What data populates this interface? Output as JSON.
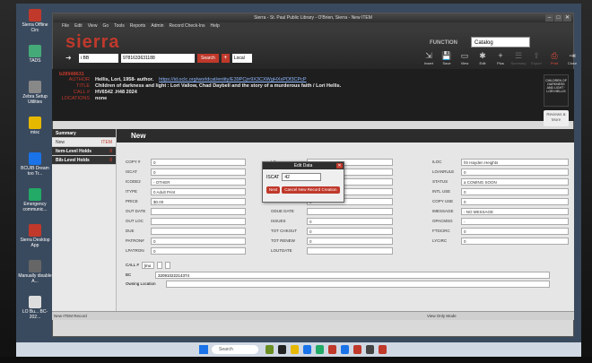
{
  "window": {
    "title": "Sierra - St. Paul Public Library - O'Brien, Sierra - New ITEM",
    "buttons": [
      "–",
      "□",
      "✕"
    ]
  },
  "menu": [
    "File",
    "Edit",
    "View",
    "Go",
    "Tools",
    "Reports",
    "Admin",
    "Record Check-Ins",
    "Help"
  ],
  "header": {
    "logo": "sierra",
    "function_label": "FUNCTION",
    "function_value": "Catalog",
    "search_index": "i BB",
    "search_value": "9781633631188",
    "search_button": "Search",
    "scope": "Local",
    "toolbar": [
      {
        "label": "Insert",
        "icon": "insert-icon",
        "glyph": "⇲",
        "state": "normal"
      },
      {
        "label": "Save",
        "icon": "save-icon",
        "glyph": "💾",
        "state": "normal"
      },
      {
        "label": "View",
        "icon": "view-icon",
        "glyph": "▭",
        "state": "normal"
      },
      {
        "label": "Edit",
        "icon": "edit-icon",
        "glyph": "✱",
        "state": "normal"
      },
      {
        "label": "Plus",
        "icon": "plus-icon",
        "glyph": "+",
        "state": "normal"
      },
      {
        "label": "Summary",
        "icon": "summary-icon",
        "glyph": "☰",
        "state": "dim"
      },
      {
        "label": "Export",
        "icon": "export-icon",
        "glyph": "⇪",
        "state": "dim"
      },
      {
        "label": "Print",
        "icon": "print-icon",
        "glyph": "⎙",
        "state": "red"
      },
      {
        "label": "Close",
        "icon": "close-icon",
        "glyph": "⇥",
        "state": "normal"
      }
    ]
  },
  "brief": {
    "record_number": "b28948631",
    "rows": [
      {
        "label": "AUTHOR",
        "value": "Hellis, Lori, 1958- author.",
        "link": "https://id.oclc.org/worldcat/entity/E39PCjrr9X3CXWgHXxPDf3CPcP"
      },
      {
        "label": "TITLE",
        "value": "Children of darkness and light : Lori Vallow, Chad Daybell and the story of a murderous faith / Lori Hellis.",
        "link": ""
      },
      {
        "label": "CALL #",
        "value": "HV6542 .H48 2024",
        "link": ""
      },
      {
        "label": "LOCATIONS",
        "value": "none",
        "link": ""
      }
    ],
    "cover_text": "CHILDREN OF DARKNESS AND LIGHT · LORI HELLIS",
    "reviews": "Reviews & More"
  },
  "nav": {
    "summary": "Summary",
    "new_label": "New",
    "new_tag": "ITEM",
    "item_holds": "Item-Level Holds",
    "bib_holds": "Bib-Level Holds",
    "count_item": "0",
    "count_bib": "0"
  },
  "main": {
    "heading": "New",
    "left_fields": [
      {
        "label": "COPY #",
        "value": "0"
      },
      {
        "label": "ISCAT",
        "value": "0"
      },
      {
        "label": "ICODE2",
        "value": "- OTHER"
      },
      {
        "label": "ITYPE",
        "value": "0 Adult Print"
      },
      {
        "label": "PRICE",
        "value": "$0.00"
      },
      {
        "label": "OUT DATE",
        "value": ""
      },
      {
        "label": "OUT LOC",
        "value": ""
      },
      {
        "label": "DUE",
        "value": ""
      },
      {
        "label": "PATRON#",
        "value": "0"
      },
      {
        "label": "LPATRON",
        "value": "0"
      }
    ],
    "mid_fields": [
      {
        "label": "LC",
        "value": ""
      },
      {
        "label": "W",
        "value": ""
      },
      {
        "label": "IN",
        "value": ""
      },
      {
        "label": "# RENEWALS",
        "value": "0"
      },
      {
        "label": "# OVERDUE",
        "value": "0"
      },
      {
        "label": "ODUE DATE",
        "value": ""
      },
      {
        "label": "ISSUES",
        "value": "0"
      },
      {
        "label": "TOT CHKOUT",
        "value": "0"
      },
      {
        "label": "TOT RENEW",
        "value": "0"
      },
      {
        "label": "LOUTDATE",
        "value": ""
      }
    ],
    "right_fields": [
      {
        "label": "ILOC",
        "value": "hh Hayden Heights"
      },
      {
        "label": "LOANRULE",
        "value": "0"
      },
      {
        "label": "STATUS",
        "value": "a COMING SOON"
      },
      {
        "label": "INTL USE",
        "value": "0"
      },
      {
        "label": "COPY USE",
        "value": "0"
      },
      {
        "label": "IMESSAGE",
        "value": "- NO MESSAGE"
      },
      {
        "label": "OPACMSG",
        "value": "-"
      },
      {
        "label": "FTDCIRC",
        "value": "0"
      },
      {
        "label": "LYCIRC",
        "value": "0"
      }
    ],
    "call_label": "CALL #",
    "call_tag": "|mo",
    "bc_label": "BC",
    "bc_value": "32091022214374",
    "owning_label": "Owning Location"
  },
  "dialog": {
    "title": "Edit Data",
    "field_label": "ISCAT",
    "field_value": "42",
    "next": "Next",
    "cancel": "Cancel New Record Creation"
  },
  "status": {
    "left": "New ITEM Record",
    "right": "View Only Mode"
  },
  "desktop": [
    {
      "name": "Sierra Offline Circ",
      "color": "#c0392b"
    },
    {
      "name": "TADS",
      "color": "#4a7"
    },
    {
      "name": "Zebra Setup Utilities",
      "color": "#888"
    },
    {
      "name": "misc",
      "color": "#e6b800"
    },
    {
      "name": "BCUIB Dream too Tr...",
      "color": "#1a73e8"
    },
    {
      "name": "Emergency communic...",
      "color": "#2a6"
    },
    {
      "name": "Sierra Desktop App",
      "color": "#c0392b"
    },
    {
      "name": "Manually disable A...",
      "color": "#666"
    },
    {
      "name": "LO Bu... BC-202...",
      "color": "#ddd"
    }
  ],
  "taskbar": {
    "search": "Search"
  }
}
